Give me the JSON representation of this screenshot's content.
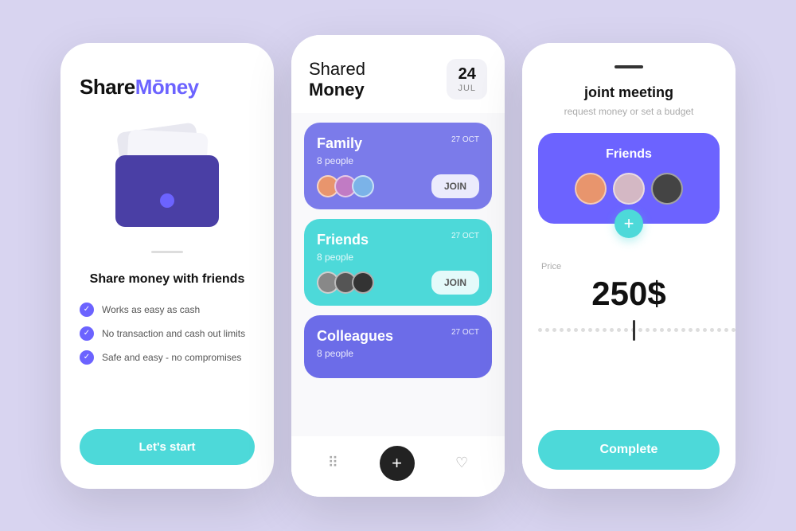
{
  "background": "#d8d4f0",
  "screen1": {
    "logo_share": "Share",
    "logo_money": "Mōney",
    "wallet_alt": "Wallet illustration",
    "divider_line": "",
    "title": "Share money with friends",
    "features": [
      {
        "text": "Works as easy as cash"
      },
      {
        "text": "No transaction and cash out limits"
      },
      {
        "text": "Safe and easy - no compromises"
      }
    ],
    "cta_label": "Let's start"
  },
  "screen2": {
    "title_top": "Shared",
    "title_bottom": "Money",
    "date_day": "24",
    "date_month": "JUL",
    "groups": [
      {
        "name": "Family",
        "people": "8 people",
        "date": "27 OCT",
        "join_label": "JOIN",
        "color_class": "family"
      },
      {
        "name": "Friends",
        "people": "8 people",
        "date": "27 OCT",
        "join_label": "JOIN",
        "color_class": "friends"
      },
      {
        "name": "Colleagues",
        "people": "8 people",
        "date": "27 OCT",
        "color_class": "colleagues"
      }
    ],
    "nav_items": [
      "grid-icon",
      "plus-icon",
      "heart-icon"
    ]
  },
  "screen3": {
    "handle_line": "",
    "title": "joint meeting",
    "subtitle": "request money or set a budget",
    "friends_card_title": "Friends",
    "price_label": "Price",
    "price_value": "250$",
    "complete_label": "Complete"
  }
}
